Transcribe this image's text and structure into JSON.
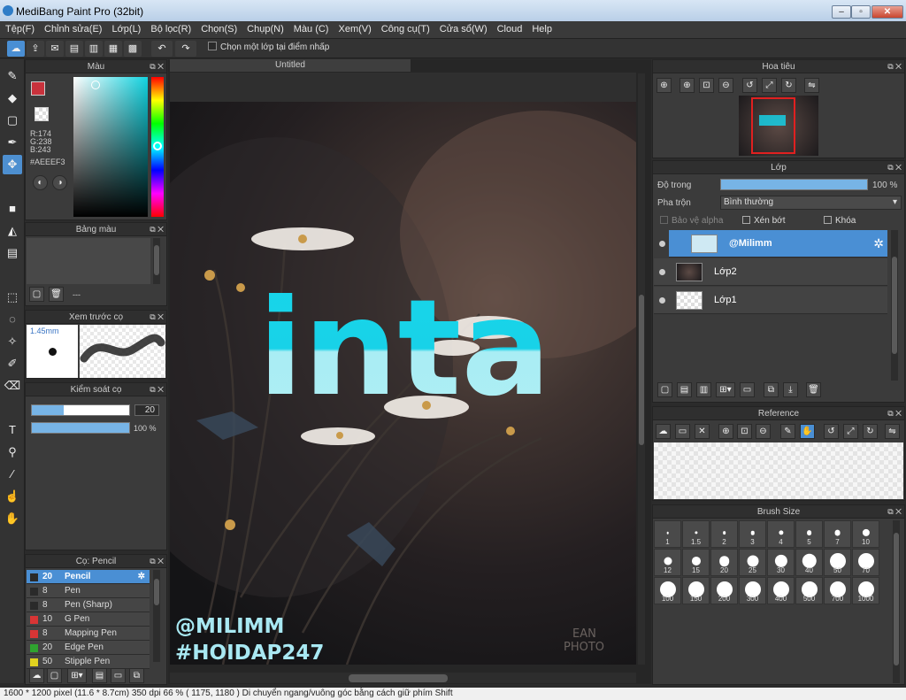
{
  "window": {
    "title": "MediBang Paint Pro (32bit)"
  },
  "menu": [
    "Tệp(F)",
    "Chỉnh sửa(E)",
    "Lớp(L)",
    "Bộ lọc(R)",
    "Chọn(S)",
    "Chụp(N)",
    "Màu (C)",
    "Xem(V)",
    "Công cụ(T)",
    "Cửa sổ(W)",
    "Cloud",
    "Help"
  ],
  "toolbar": {
    "checkbox_label": "Chọn một lớp tại điểm nhấp"
  },
  "tools": [
    "brush",
    "eraser",
    "rect-select",
    "pen",
    "move",
    "fill-rect",
    "bucket",
    "gradient",
    "select-rect",
    "lasso",
    "magic-wand",
    "select-pen",
    "select-eraser",
    "text",
    "divide",
    "eyedropper",
    "hand-select",
    "hand"
  ],
  "color_panel": {
    "title": "Màu",
    "r": "R:174",
    "g": "G:238",
    "b": "B:243",
    "hex": "#AEEEF3",
    "primary": "#c8323c"
  },
  "palette_panel": {
    "title": "Bảng màu",
    "footer": "---"
  },
  "brush_preview": {
    "title": "Xem trước cọ",
    "size": "1.45mm"
  },
  "brush_control": {
    "title": "Kiểm soát cọ",
    "size_value": "20",
    "opacity_value": "100 %",
    "size_fill": 0.33,
    "opacity_fill": 1.0
  },
  "brush_list": {
    "title": "Cọ: Pencil",
    "items": [
      {
        "size": "20",
        "name": "Pencil",
        "color": "#2a2a2a"
      },
      {
        "size": "8",
        "name": "Pen",
        "color": "#2a2a2a"
      },
      {
        "size": "8",
        "name": "Pen (Sharp)",
        "color": "#2a2a2a"
      },
      {
        "size": "10",
        "name": "G Pen",
        "color": "#d83535"
      },
      {
        "size": "8",
        "name": "Mapping Pen",
        "color": "#d83535"
      },
      {
        "size": "20",
        "name": "Edge Pen",
        "color": "#2fa32f"
      },
      {
        "size": "50",
        "name": "Stipple Pen",
        "color": "#e0d21f"
      }
    ]
  },
  "document": {
    "tab": "Untitled",
    "art_text": "inta",
    "watermark_1": "@MILIMM",
    "watermark_2": "#HOIDAP247",
    "corner_text_1": "EAN",
    "corner_text_2": "PHOTO"
  },
  "navigator": {
    "title": "Hoa tiêu"
  },
  "layer_panel": {
    "title": "Lớp",
    "opacity_label": "Độ trong",
    "opacity_value": "100 %",
    "blend_label": "Pha trộn",
    "blend_value": "Bình thường",
    "protect_alpha": "Bảo vệ alpha",
    "clip": "Xén bớt",
    "lock": "Khóa",
    "layers": [
      {
        "name": "@Milimm",
        "selected": true
      },
      {
        "name": "Lớp2",
        "selected": false
      },
      {
        "name": "Lớp1",
        "selected": false
      }
    ]
  },
  "reference_panel": {
    "title": "Reference"
  },
  "brush_size_panel": {
    "title": "Brush Size",
    "sizes": [
      "1",
      "1.5",
      "2",
      "3",
      "4",
      "5",
      "7",
      "10",
      "12",
      "15",
      "20",
      "25",
      "30",
      "40",
      "50",
      "70",
      "100",
      "150",
      "200",
      "300",
      "400",
      "500",
      "700",
      "1000"
    ]
  },
  "status": {
    "dimensions": "1600 * 1200 pixel",
    "physical": "(11.6 * 8.7cm)",
    "dpi": "350 dpi",
    "zoom": "66 %",
    "cursor": "( 1175, 1180 )",
    "hint": "Di chuyển ngang/vuông góc bằng cách giữ phím Shift"
  }
}
